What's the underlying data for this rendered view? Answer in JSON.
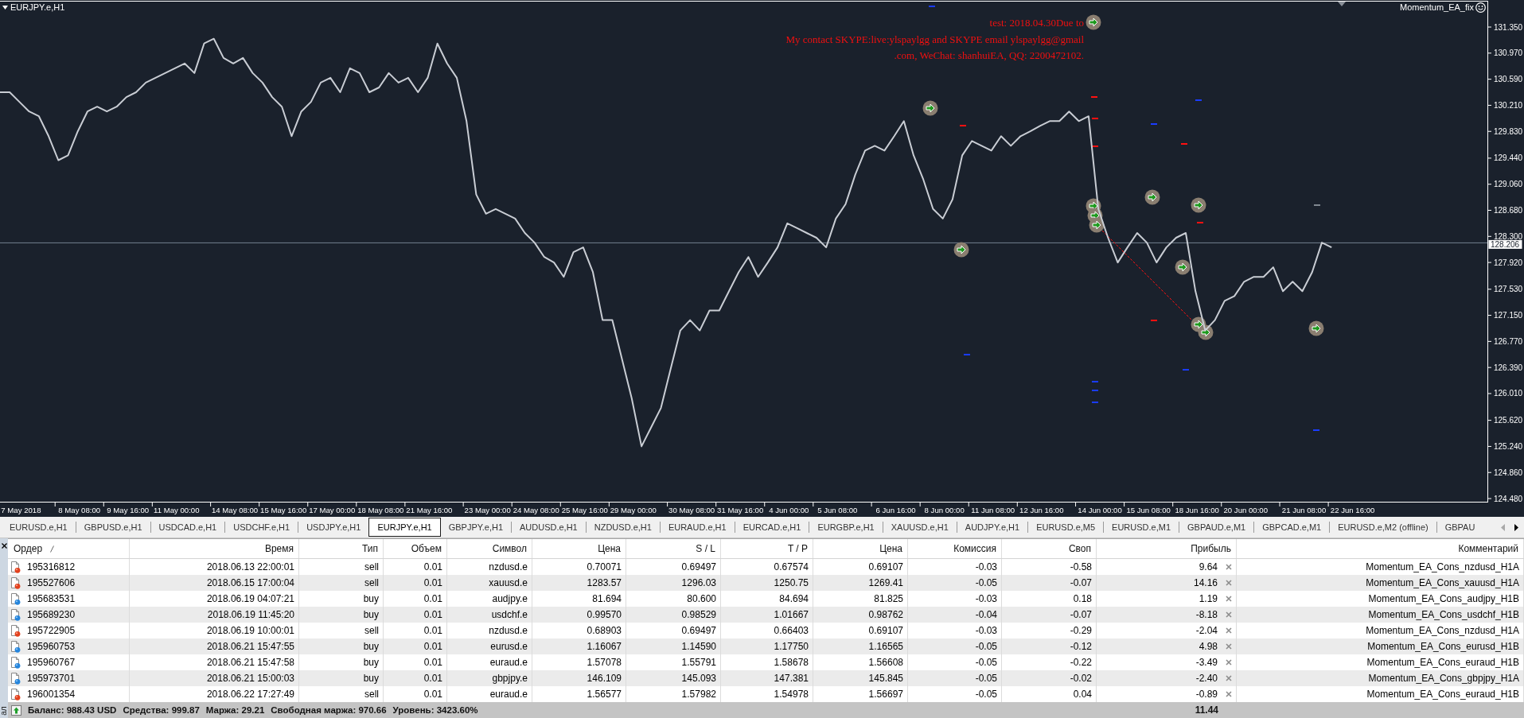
{
  "chart": {
    "expert": {
      "name": "Momentum_EA_fix",
      "active": true
    },
    "comment_lines": [
      "test: 2018.04.30Due to",
      "My contact SKYPE:live:ylspaylgg and SKYPE email ylspaylgg@gmail",
      ".com, WeChat: shanhuiEA, QQ: 2200472102."
    ],
    "chart_data": {
      "type": "line",
      "categories": [
        null,
        null,
        "7 May 2018",
        null,
        null,
        null,
        null,
        null,
        "8 May 08:00",
        null,
        null,
        null,
        null,
        "9 May 16:00",
        null,
        null,
        null,
        null,
        "11 May 00:00",
        null,
        null,
        null,
        null,
        null,
        "14 May 08:00",
        null,
        null,
        null,
        null,
        "15 May 16:00",
        null,
        null,
        null,
        null,
        "17 May 00:00",
        null,
        null,
        null,
        null,
        "18 May 08:00",
        null,
        null,
        null,
        null,
        "21 May 16:00",
        null,
        null,
        null,
        null,
        null,
        "23 May 00:00",
        null,
        null,
        null,
        null,
        "24 May 08:00",
        null,
        null,
        null,
        null,
        "25 May 16:00",
        null,
        null,
        null,
        null,
        "29 May 00:00",
        null,
        null,
        null,
        null,
        null,
        "30 May 08:00",
        null,
        null,
        null,
        null,
        "31 May 16:00",
        null,
        null,
        null,
        null,
        "4 Jun 00:00",
        null,
        null,
        null,
        null,
        "5 Jun 08:00",
        null,
        null,
        null,
        null,
        null,
        "6 Jun 16:00",
        null,
        null,
        null,
        null,
        "8 Jun 00:00",
        null,
        null,
        null,
        null,
        "11 Jun 08:00",
        null,
        null,
        null,
        null,
        "12 Jun 16:00",
        null,
        null,
        null,
        null,
        null,
        "14 Jun 00:00",
        null,
        null,
        null,
        null,
        "15 Jun 08:00",
        null,
        null,
        null,
        null,
        "18 Jun 16:00",
        null,
        null,
        null,
        null,
        "20 Jun 00:00",
        null,
        null,
        null,
        null,
        null,
        "21 Jun 08:00",
        null,
        null,
        null,
        null,
        "22 Jun 16:00"
      ],
      "series": [
        {
          "name": "EURJPY.e,H1",
          "color": "#c9cdd4",
          "values": [
            130.4,
            130.4,
            130.26,
            130.12,
            130.05,
            129.76,
            129.41,
            129.48,
            129.83,
            130.12,
            130.19,
            130.12,
            130.19,
            130.33,
            130.4,
            130.54,
            130.61,
            130.68,
            130.75,
            130.82,
            130.68,
            131.11,
            131.18,
            130.9,
            130.82,
            130.9,
            130.68,
            130.54,
            130.33,
            130.19,
            129.76,
            130.12,
            130.26,
            130.54,
            130.61,
            130.4,
            130.75,
            130.68,
            130.4,
            130.47,
            130.68,
            130.54,
            130.61,
            130.4,
            130.61,
            131.11,
            130.82,
            130.61,
            129.98,
            128.91,
            128.63,
            128.7,
            128.63,
            128.56,
            128.35,
            128.21,
            128.0,
            127.92,
            127.71,
            128.07,
            128.14,
            127.78,
            127.08,
            127.08,
            126.51,
            125.94,
            125.24,
            125.52,
            125.8,
            126.37,
            126.93,
            127.08,
            126.93,
            127.22,
            127.22,
            127.5,
            127.78,
            128.0,
            127.71,
            127.92,
            128.14,
            128.49,
            128.42,
            128.35,
            128.28,
            128.14,
            128.56,
            128.77,
            129.2,
            129.55,
            129.62,
            129.55,
            129.76,
            129.98,
            129.48,
            129.13,
            128.7,
            128.56,
            128.84,
            129.48,
            129.69,
            129.62,
            129.55,
            129.76,
            129.62,
            129.76,
            129.83,
            129.91,
            129.98,
            129.98,
            130.12,
            129.98,
            130.05,
            128.7,
            128.28,
            127.92,
            128.14,
            128.35,
            128.21,
            127.92,
            128.14,
            128.28,
            128.35,
            127.5,
            126.93,
            127.08,
            127.36,
            127.43,
            127.64,
            127.71,
            127.71,
            127.85,
            127.5,
            127.64,
            127.5,
            127.78,
            128.21,
            128.14,
            null,
            null
          ]
        }
      ],
      "ylim": [
        124.434,
        131.721
      ],
      "yticks": [
        {
          "value": 131.35,
          "label": "131.350"
        },
        {
          "value": 130.97,
          "label": "130.970"
        },
        {
          "value": 130.59,
          "label": "130.590"
        },
        {
          "value": 130.21,
          "label": "130.210"
        },
        {
          "value": 129.83,
          "label": "129.830"
        },
        {
          "value": 129.44,
          "label": "129.440"
        },
        {
          "value": 129.06,
          "label": "129.060"
        },
        {
          "value": 128.68,
          "label": "128.680"
        },
        {
          "value": 128.3,
          "label": "128.300"
        },
        {
          "value": 127.92,
          "label": "127.920"
        },
        {
          "value": 127.53,
          "label": "127.530"
        },
        {
          "value": 127.15,
          "label": "127.150"
        },
        {
          "value": 126.77,
          "label": "126.770"
        },
        {
          "value": 126.39,
          "label": "126.390"
        },
        {
          "value": 126.01,
          "label": "126.010"
        },
        {
          "value": 125.62,
          "label": "125.620"
        },
        {
          "value": 125.24,
          "label": "125.240"
        },
        {
          "value": 124.86,
          "label": "124.860"
        },
        {
          "value": 124.48,
          "label": "124.480"
        }
      ],
      "ref_lines": [
        {
          "axis": "y",
          "value": 128.206,
          "label": "128.206"
        }
      ]
    }
  },
  "symbol_tabs": [
    {
      "label": "EURUSD.e,H1",
      "selected": false
    },
    {
      "label": "GBPUSD.e,H1",
      "selected": false
    },
    {
      "label": "USDCAD.e,H1",
      "selected": false
    },
    {
      "label": "USDCHF.e,H1",
      "selected": false
    },
    {
      "label": "USDJPY.e,H1",
      "selected": false
    },
    {
      "label": "EURJPY.e,H1",
      "selected": true
    },
    {
      "label": "GBPJPY.e,H1",
      "selected": false
    },
    {
      "label": "AUDUSD.e,H1",
      "selected": false
    },
    {
      "label": "NZDUSD.e,H1",
      "selected": false
    },
    {
      "label": "EURAUD.e,H1",
      "selected": false
    },
    {
      "label": "EURCAD.e,H1",
      "selected": false
    },
    {
      "label": "EURGBP.e,H1",
      "selected": false
    },
    {
      "label": "XAUUSD.e,H1",
      "selected": false
    },
    {
      "label": "AUDJPY.e,H1",
      "selected": false
    },
    {
      "label": "EURUSD.e,M5",
      "selected": false
    },
    {
      "label": "EURUSD.e,M1",
      "selected": false
    },
    {
      "label": "GBPAUD.e,M1",
      "selected": false
    },
    {
      "label": "GBPCAD.e,M1",
      "selected": false
    },
    {
      "label": "EURUSD.e,M2 (offline)",
      "selected": false
    },
    {
      "label": "GBPAU",
      "selected": false
    }
  ],
  "tab_scroll": {
    "left_disabled": true,
    "right_disabled": false
  },
  "terminal": {
    "title": "ал",
    "columns": [
      {
        "label": "Ордер",
        "kind": "order",
        "sorted": true
      },
      {
        "label": "Время",
        "kind": "text",
        "sorted": false
      },
      {
        "label": "Тип",
        "kind": "text",
        "sorted": false
      },
      {
        "label": "Объем",
        "kind": "text",
        "sorted": false
      },
      {
        "label": "Символ",
        "kind": "text",
        "sorted": false
      },
      {
        "label": "Цена",
        "kind": "text",
        "sorted": false
      },
      {
        "label": "S / L",
        "kind": "text",
        "sorted": false
      },
      {
        "label": "T / P",
        "kind": "text",
        "sorted": false
      },
      {
        "label": "Цена",
        "kind": "text",
        "sorted": false
      },
      {
        "label": "Комиссия",
        "kind": "text",
        "sorted": false
      },
      {
        "label": "Своп",
        "kind": "text",
        "sorted": false
      },
      {
        "label": "Прибыль",
        "kind": "profit",
        "sorted": false
      },
      {
        "label": "Комментарий",
        "kind": "text",
        "sorted": false
      }
    ],
    "rows": [
      {
        "kind": "sell",
        "cells": [
          "195316812",
          "2018.06.13 22:00:01",
          "sell",
          "0.01",
          "nzdusd.e",
          "0.70071",
          "0.69497",
          "0.67574",
          "0.69107",
          "-0.03",
          "-0.58",
          "9.64",
          "Momentum_EA_Cons_nzdusd_H1A"
        ]
      },
      {
        "kind": "sell",
        "cells": [
          "195527606",
          "2018.06.15 17:00:04",
          "sell",
          "0.01",
          "xauusd.e",
          "1283.57",
          "1296.03",
          "1250.75",
          "1269.41",
          "-0.05",
          "-0.07",
          "14.16",
          "Momentum_EA_Cons_xauusd_H1A"
        ]
      },
      {
        "kind": "buy",
        "cells": [
          "195683531",
          "2018.06.19 04:07:21",
          "buy",
          "0.01",
          "audjpy.e",
          "81.694",
          "80.600",
          "84.694",
          "81.825",
          "-0.03",
          "0.18",
          "1.19",
          "Momentum_EA_Cons_audjpy_H1B"
        ]
      },
      {
        "kind": "buy",
        "cells": [
          "195689230",
          "2018.06.19 11:45:20",
          "buy",
          "0.01",
          "usdchf.e",
          "0.99570",
          "0.98529",
          "1.01667",
          "0.98762",
          "-0.04",
          "-0.07",
          "-8.18",
          "Momentum_EA_Cons_usdchf_H1B"
        ]
      },
      {
        "kind": "sell",
        "cells": [
          "195722905",
          "2018.06.19 10:00:01",
          "sell",
          "0.01",
          "nzdusd.e",
          "0.68903",
          "0.69497",
          "0.66403",
          "0.69107",
          "-0.03",
          "-0.29",
          "-2.04",
          "Momentum_EA_Cons_nzdusd_H1A"
        ]
      },
      {
        "kind": "buy",
        "cells": [
          "195960753",
          "2018.06.21 15:47:55",
          "buy",
          "0.01",
          "eurusd.e",
          "1.16067",
          "1.14590",
          "1.17750",
          "1.16565",
          "-0.05",
          "-0.12",
          "4.98",
          "Momentum_EA_Cons_eurusd_H1B"
        ]
      },
      {
        "kind": "buy",
        "cells": [
          "195960767",
          "2018.06.21 15:47:58",
          "buy",
          "0.01",
          "euraud.e",
          "1.57078",
          "1.55791",
          "1.58678",
          "1.56608",
          "-0.05",
          "-0.22",
          "-3.49",
          "Momentum_EA_Cons_euraud_H1B"
        ]
      },
      {
        "kind": "buy",
        "cells": [
          "195973701",
          "2018.06.21 15:00:03",
          "buy",
          "0.01",
          "gbpjpy.e",
          "146.109",
          "145.093",
          "147.381",
          "145.845",
          "-0.05",
          "-0.02",
          "-2.40",
          "Momentum_EA_Cons_gbpjpy_H1A"
        ]
      },
      {
        "kind": "sell",
        "cells": [
          "196001354",
          "2018.06.22 17:27:49",
          "sell",
          "0.01",
          "euraud.e",
          "1.56577",
          "1.57982",
          "1.54978",
          "1.56697",
          "-0.05",
          "0.04",
          "-0.89",
          "Momentum_EA_Cons_euraud_H1B"
        ]
      }
    ],
    "footer": {
      "items": [
        "Баланс: 988.43 USD",
        "Средства: 999.87",
        "Маржа: 29.21",
        "Свободная маржа: 970.66",
        "Уровень: 3423.60%"
      ],
      "total_profit": "11.44"
    }
  }
}
